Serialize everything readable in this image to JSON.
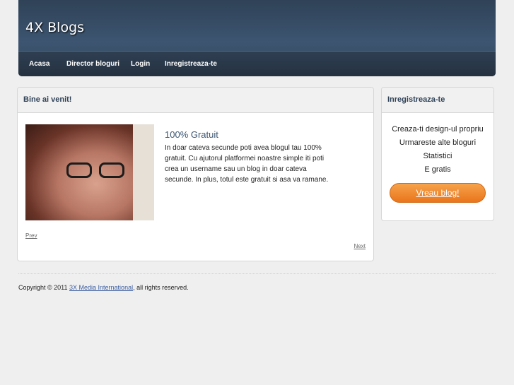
{
  "site": {
    "title": "4X Blogs"
  },
  "nav": {
    "items": [
      {
        "label": "Acasa"
      },
      {
        "label": "Director bloguri"
      },
      {
        "label": "Login"
      },
      {
        "label": "Inregistreaza-te"
      }
    ]
  },
  "welcome": {
    "heading": "Bine ai venit!",
    "slide_title": "100% Gratuit",
    "slide_body": "In doar cateva secunde poti avea blogul tau 100% gratuit. Cu ajutorul platformei noastre simple iti poti crea un username sau un blog in doar cateva secunde. In plus, totul este gratuit si asa va ramane.",
    "prev_label": "Prev",
    "next_label": "Next"
  },
  "signup": {
    "heading": "Inregistreaza-te",
    "features": [
      "Creaza-ti design-ul propriu",
      "Urmareste alte bloguri",
      "Statistici",
      "E gratis"
    ],
    "cta_label": "Vreau blog!"
  },
  "footer": {
    "prefix": "Copyright © 2011 ",
    "company": "3X Media International",
    "suffix": ", all rights reserved."
  },
  "colors": {
    "header": "#3d5571",
    "nav": "#2a3949",
    "accent": "#ee7f22",
    "background": "#efefef"
  }
}
